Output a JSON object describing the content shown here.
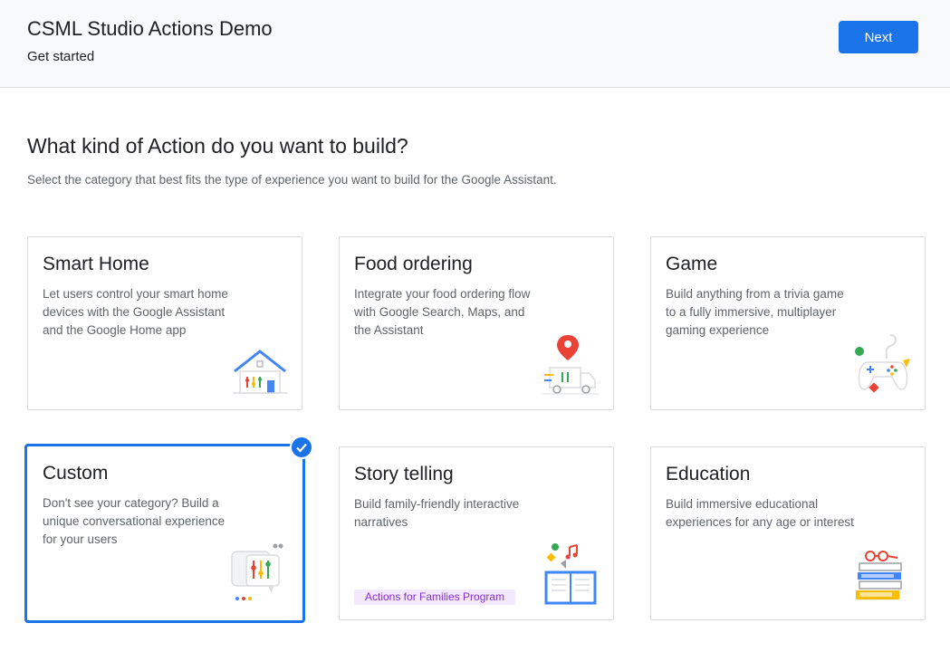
{
  "header": {
    "app_title": "CSML Studio Actions Demo",
    "subtitle": "Get started",
    "next_label": "Next"
  },
  "main": {
    "heading": "What kind of Action do you want to build?",
    "description": "Select the category that best fits the type of experience you want to build for the Google Assistant."
  },
  "cards": [
    {
      "title": "Smart Home",
      "description": "Let users control your smart home devices with the Google Assistant and the Google Home app",
      "icon": "smart-home-icon",
      "selected": false
    },
    {
      "title": "Food ordering",
      "description": "Integrate your food ordering flow with Google Search, Maps, and the Assistant",
      "icon": "food-truck-icon",
      "selected": false
    },
    {
      "title": "Game",
      "description": "Build anything from a trivia game to a fully immersive, multiplayer gaming experience",
      "icon": "game-controller-icon",
      "selected": false
    },
    {
      "title": "Custom",
      "description": "Don't see your category? Build a unique conversational experience for your users",
      "icon": "custom-chat-icon",
      "selected": true
    },
    {
      "title": "Story telling",
      "description": "Build family-friendly interactive narratives",
      "icon": "storybook-icon",
      "badge": "Actions for Families Program",
      "selected": false
    },
    {
      "title": "Education",
      "description": "Build immersive educational experiences for any age or interest",
      "icon": "books-icon",
      "selected": false
    }
  ],
  "colors": {
    "accent": "#1a73e8",
    "header_bg": "#f8f9fa",
    "badge_bg": "#f3e8fd",
    "badge_text": "#8430ce"
  }
}
